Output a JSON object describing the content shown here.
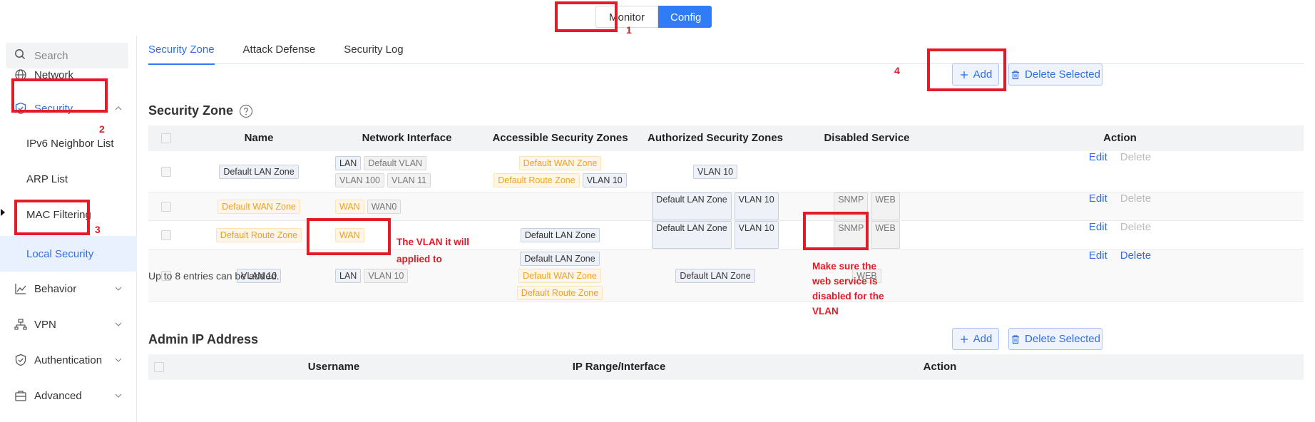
{
  "mode_switch": {
    "monitor_label": "Monitor",
    "config_label": "Config"
  },
  "sidebar": {
    "search_placeholder": "Search",
    "network_label": "Network",
    "security_label": "Security",
    "sub_items": [
      "IPv6 Neighbor List",
      "ARP List",
      "MAC Filtering",
      "Local Security"
    ],
    "behavior_label": "Behavior",
    "vpn_label": "VPN",
    "authentication_label": "Authentication",
    "advanced_label": "Advanced"
  },
  "tabs": [
    "Security Zone",
    "Attack Defense",
    "Security Log"
  ],
  "security_zone": {
    "title": "Security Zone",
    "add_label": "Add",
    "delete_selected_label": "Delete Selected",
    "columns": [
      "Name",
      "Network Interface",
      "Accessible Security Zones",
      "Authorized Security Zones",
      "Disabled Service",
      "Action"
    ],
    "rows": [
      {
        "name": "Default LAN Zone",
        "interfaces": [
          "LAN",
          "Default VLAN",
          "VLAN 100",
          "VLAN 11"
        ],
        "accessible": [
          "Default WAN Zone",
          "Default Route Zone",
          "VLAN 10"
        ],
        "authorized": [
          "VLAN 10"
        ],
        "disabled_service": [],
        "edit": "Edit",
        "delete": "Delete"
      },
      {
        "name": "Default WAN Zone",
        "interfaces": [
          "WAN",
          "WAN0"
        ],
        "accessible": [],
        "authorized": [
          "Default LAN Zone",
          "VLAN 10"
        ],
        "disabled_service": [
          "SNMP",
          "WEB"
        ],
        "edit": "Edit",
        "delete": "Delete"
      },
      {
        "name": "Default Route Zone",
        "interfaces": [
          "WAN"
        ],
        "accessible": [
          "Default LAN Zone"
        ],
        "authorized": [
          "Default LAN Zone",
          "VLAN 10"
        ],
        "disabled_service": [
          "SNMP",
          "WEB"
        ],
        "edit": "Edit",
        "delete": "Delete"
      },
      {
        "name": "VLAN 10",
        "interfaces": [
          "LAN",
          "VLAN 10"
        ],
        "accessible": [
          "Default LAN Zone",
          "Default WAN Zone",
          "Default Route Zone"
        ],
        "authorized": [
          "Default LAN Zone"
        ],
        "disabled_service": [
          "WEB"
        ],
        "edit": "Edit",
        "delete": "Delete"
      }
    ],
    "footnote": "Up to 8 entries can be added."
  },
  "admin_ip": {
    "title": "Admin IP Address",
    "add_label": "Add",
    "delete_selected_label": "Delete Selected",
    "columns": [
      "Username",
      "IP Range/Interface",
      "Action"
    ]
  },
  "annotations": {
    "num1": "1",
    "num2": "2",
    "num3": "3",
    "num4": "4",
    "vlan_note": "The VLAN it will applied to",
    "web_note": "Make sure the web service is disabled for the VLAN"
  },
  "colors": {
    "accent": "#2f7cf6",
    "annotation": "#e21b26",
    "orange_tag": "#f0a020"
  }
}
